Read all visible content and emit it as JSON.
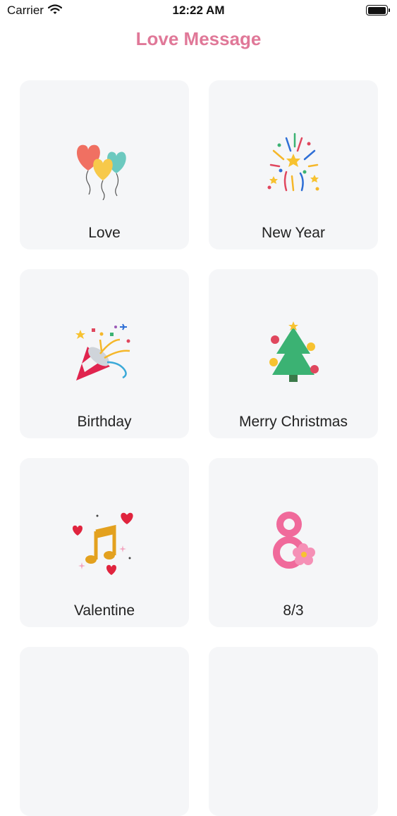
{
  "status_bar": {
    "carrier": "Carrier",
    "time": "12:22 AM"
  },
  "header": {
    "title": "Love Message"
  },
  "categories": [
    {
      "label": "Love",
      "icon": "balloons-icon"
    },
    {
      "label": "New Year",
      "icon": "fireworks-icon"
    },
    {
      "label": "Birthday",
      "icon": "party-popper-icon"
    },
    {
      "label": "Merry Christmas",
      "icon": "christmas-tree-icon"
    },
    {
      "label": "Valentine",
      "icon": "music-hearts-icon"
    },
    {
      "label": "8/3",
      "icon": "number-eight-flower-icon"
    },
    {
      "label": "",
      "icon": "partial-icon"
    },
    {
      "label": "",
      "icon": "partial-icon"
    }
  ],
  "colors": {
    "title": "#e07898",
    "card_background": "#f5f6f8"
  }
}
